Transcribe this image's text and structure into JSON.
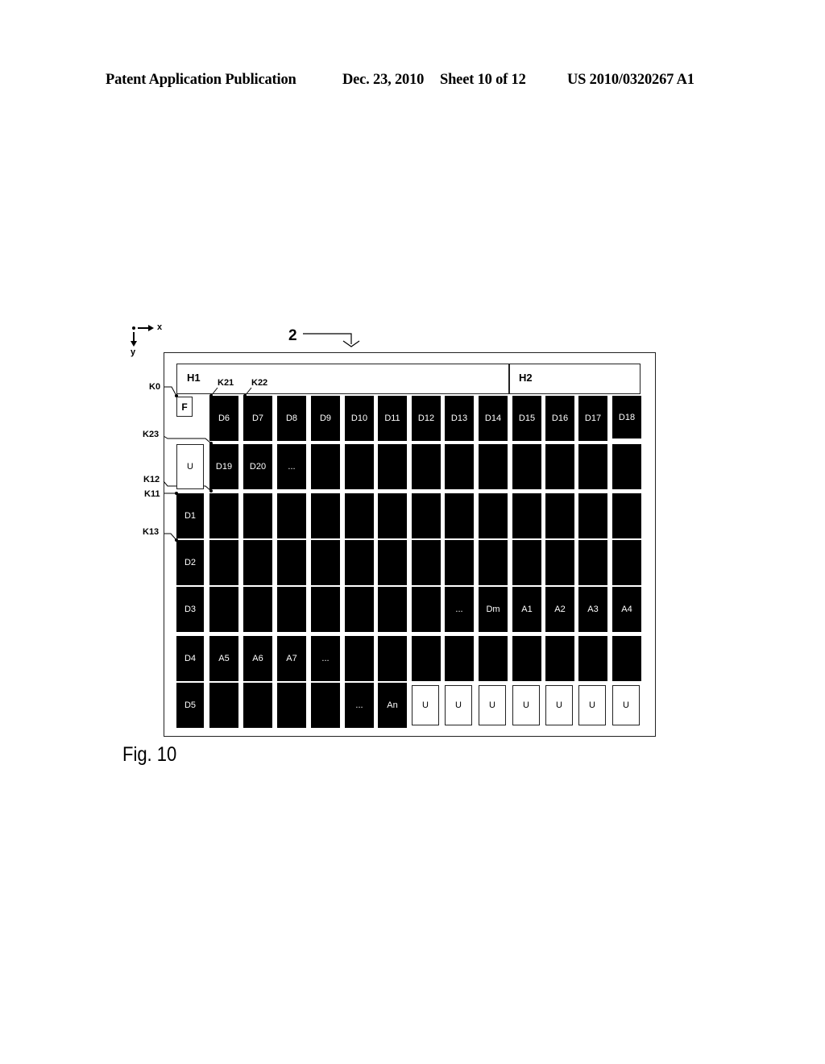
{
  "header": {
    "publication": "Patent Application Publication",
    "date": "Dec. 23, 2010",
    "sheet": "Sheet 10 of 12",
    "number": "US 2010/0320267 A1"
  },
  "axes": {
    "x": "x",
    "y": "y"
  },
  "figure_ref": "2",
  "header_fields": {
    "h1": "H1",
    "h2": "H2"
  },
  "reference_labels": {
    "k0": "K0",
    "k21": "K21",
    "k22": "K22",
    "k23": "K23",
    "k12": "K12",
    "k11": "K11",
    "k13": "K13"
  },
  "grid": {
    "rows": [
      {
        "first": {
          "label": "F",
          "style": "white-small"
        },
        "cells": [
          "D6",
          "D7",
          "D8",
          "D9",
          "D10",
          "D11",
          "D12",
          "D13",
          "D14",
          "D15",
          "D16",
          "D17",
          "D18"
        ]
      },
      {
        "first": {
          "label": "U",
          "style": "white"
        },
        "cells": [
          "D19",
          "D20",
          "...",
          "",
          "",
          "",
          "",
          "",
          "",
          "",
          "",
          "",
          ""
        ]
      },
      {
        "first": {
          "label": "D1",
          "style": "black"
        },
        "cells": [
          "",
          "",
          "",
          "",
          "",
          "",
          "",
          "",
          "",
          "",
          "",
          "",
          ""
        ]
      },
      {
        "first": {
          "label": "D2",
          "style": "black"
        },
        "cells": [
          "",
          "",
          "",
          "",
          "",
          "",
          "",
          "",
          "",
          "",
          "",
          "",
          ""
        ]
      },
      {
        "first": {
          "label": "D3",
          "style": "black"
        },
        "cells": [
          "",
          "",
          "",
          "",
          "",
          "",
          "",
          "...",
          "Dm",
          "A1",
          "A2",
          "A3",
          "A4"
        ]
      },
      {
        "first": {
          "label": "D4",
          "style": "black"
        },
        "cells": [
          "A5",
          "A6",
          "A7",
          "...",
          "",
          "",
          "",
          "",
          "",
          "",
          "",
          "",
          ""
        ]
      },
      {
        "first": {
          "label": "D5",
          "style": "black"
        },
        "cells": [
          "",
          "",
          "",
          "",
          "...",
          "An",
          "U",
          "U",
          "U",
          "U",
          "U",
          "U",
          "U"
        ]
      }
    ],
    "white_cells": {
      "row": 6,
      "from_col": 6
    }
  },
  "caption": "Fig. 10"
}
